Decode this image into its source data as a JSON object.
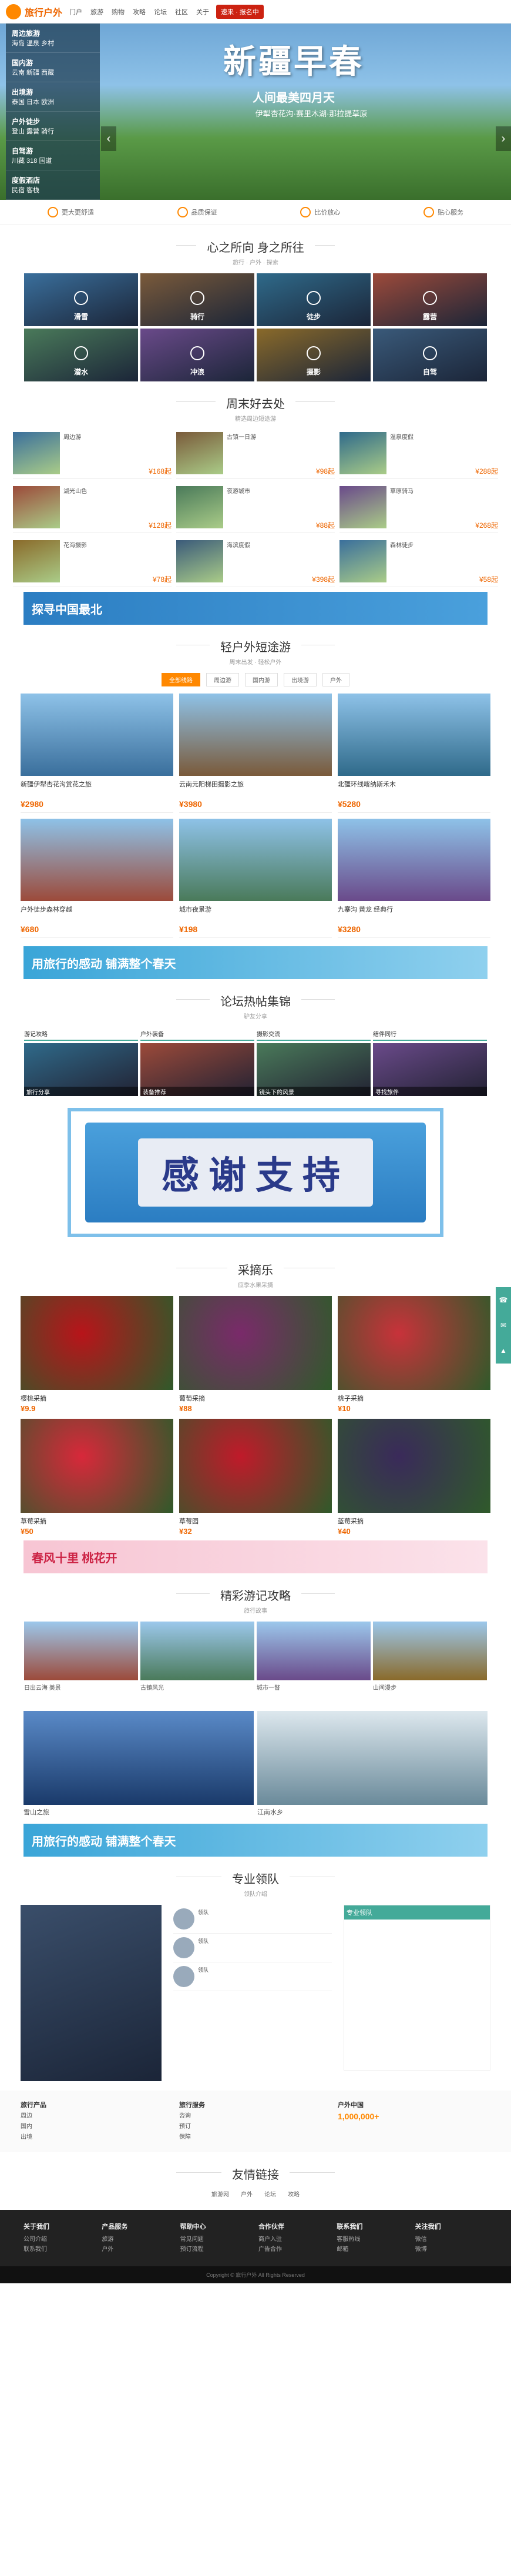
{
  "header": {
    "logo": "旅行户外",
    "nav": [
      "门户",
      "旅游",
      "购物",
      "攻略",
      "论坛",
      "社区",
      "关于"
    ],
    "ad": "速来 · 报名中"
  },
  "hero": {
    "title": "新疆早春",
    "sub": "人间最美四月天",
    "desc": "伊犁杏花沟·赛里木湖·那拉提草原",
    "menu": [
      {
        "t": "周边旅游",
        "s": "海岛 温泉 乡村"
      },
      {
        "t": "国内游",
        "s": "云南 新疆 西藏"
      },
      {
        "t": "出境游",
        "s": "泰国 日本 欧洲"
      },
      {
        "t": "户外徒步",
        "s": "登山 露营 骑行"
      },
      {
        "t": "自驾游",
        "s": "川藏 318 国道"
      },
      {
        "t": "度假酒店",
        "s": "民宿 客栈"
      }
    ]
  },
  "features": [
    "更大更舒适",
    "品质保证",
    "比价放心",
    "贴心服务"
  ],
  "sections": {
    "heart": {
      "title": "心之所向 身之所往",
      "sub": "旅行 · 户外 · 探索"
    },
    "weekend": {
      "title": "周末好去处",
      "sub": "精选周边短途游"
    },
    "short": {
      "title": "轻户外短途游",
      "sub": "周末出发 · 轻松户外"
    },
    "forum": {
      "title": "论坛热帖集锦",
      "sub": "驴友分享"
    },
    "fruit": {
      "title": "采摘乐",
      "sub": "应季水果采摘"
    },
    "travel": {
      "title": "精彩游记攻略",
      "sub": "旅行故事"
    },
    "guide": {
      "title": "专业领队",
      "sub": "领队介绍"
    },
    "links": {
      "title": "友情链接"
    }
  },
  "tiles": [
    "滑雪",
    "骑行",
    "徒步",
    "露营",
    "潜水",
    "冲浪",
    "摄影",
    "自驾"
  ],
  "weekend": [
    {
      "t": "周边游",
      "p": "¥168起"
    },
    {
      "t": "古镇一日游",
      "p": "¥98起"
    },
    {
      "t": "温泉度假",
      "p": "¥288起"
    },
    {
      "t": "湖光山色",
      "p": "¥128起"
    },
    {
      "t": "夜游城市",
      "p": "¥88起"
    },
    {
      "t": "草原骑马",
      "p": "¥268起"
    },
    {
      "t": "花海摄影",
      "p": "¥78起"
    },
    {
      "t": "海滨度假",
      "p": "¥398起"
    },
    {
      "t": "森林徒步",
      "p": "¥58起"
    }
  ],
  "ad1": "探寻中国最北",
  "ad2": "用旅行的感动 铺满整个春天",
  "tourTabs": [
    "全部线路",
    "周边游",
    "国内游",
    "出境游",
    "户外"
  ],
  "tours": [
    {
      "n": "新疆伊犁杏花沟赏花之旅",
      "p": "¥2980"
    },
    {
      "n": "云南元阳梯田摄影之旅",
      "p": "¥3980"
    },
    {
      "n": "北疆环线喀纳斯禾木",
      "p": "¥5280"
    },
    {
      "n": "户外徒步森林穿越",
      "p": "¥680"
    },
    {
      "n": "城市夜景游",
      "p": "¥198"
    },
    {
      "n": "九寨沟 黄龙 经典行",
      "p": "¥3280"
    }
  ],
  "forum": [
    {
      "h": "游记攻略",
      "c": "旅行分享"
    },
    {
      "h": "户外装备",
      "c": "装备推荐"
    },
    {
      "h": "摄影交流",
      "c": "镜头下的风景"
    },
    {
      "h": "结伴同行",
      "c": "寻找旅伴"
    }
  ],
  "thanks": "感谢支持",
  "fruits": [
    {
      "n": "樱桃采摘",
      "p": "¥9.9"
    },
    {
      "n": "葡萄采摘",
      "p": "¥88"
    },
    {
      "n": "桃子采摘",
      "p": "¥10"
    },
    {
      "n": "草莓采摘",
      "p": "¥50"
    },
    {
      "n": "草莓园",
      "p": "¥32"
    },
    {
      "n": "蓝莓采摘",
      "p": "¥40"
    }
  ],
  "ad3": "春风十里 桃花开",
  "travels": [
    {
      "n": "日出云海 美景"
    },
    {
      "n": "古镇风光"
    },
    {
      "n": "城市一瞥"
    },
    {
      "n": "山间漫步"
    }
  ],
  "bigTravels": [
    {
      "n": "雪山之旅"
    },
    {
      "n": "江南水乡"
    }
  ],
  "leaders": [
    {
      "n": "领队"
    },
    {
      "n": "领队"
    },
    {
      "n": "领队"
    }
  ],
  "stats": [
    {
      "h": "旅行产品",
      "l": [
        "周边",
        "国内",
        "出境"
      ]
    },
    {
      "h": "旅行服务",
      "l": [
        "咨询",
        "预订",
        "保障"
      ]
    },
    {
      "h": "户外中国",
      "n": "1,000,000+"
    }
  ],
  "links": [
    "旅游网",
    "户外",
    "论坛",
    "攻略"
  ],
  "footer": [
    {
      "h": "关于我们",
      "l": [
        "公司介绍",
        "联系我们"
      ]
    },
    {
      "h": "产品服务",
      "l": [
        "旅游",
        "户外"
      ]
    },
    {
      "h": "帮助中心",
      "l": [
        "常见问题",
        "预订流程"
      ]
    },
    {
      "h": "合作伙伴",
      "l": [
        "商户入驻",
        "广告合作"
      ]
    },
    {
      "h": "联系我们",
      "l": [
        "客服热线",
        "邮箱"
      ]
    },
    {
      "h": "关注我们",
      "l": [
        "微信",
        "微博"
      ]
    }
  ],
  "copy": "Copyright © 旅行户外 All Rights Reserved"
}
